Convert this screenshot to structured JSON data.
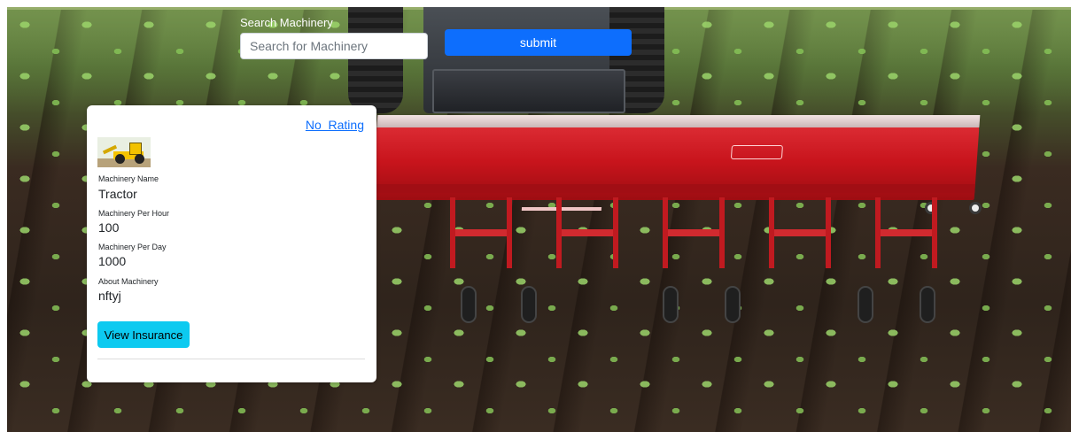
{
  "page": {
    "heading": ""
  },
  "search": {
    "label": "Search Machinery",
    "placeholder": "Search for Machinery",
    "value": "",
    "submit_label": "submit"
  },
  "card": {
    "rating_link": "No  Rating",
    "image_icon": "excavator-image",
    "fields": [
      {
        "label": "Machinery Name",
        "value": "Tractor"
      },
      {
        "label": "Machinery Per Hour",
        "value": "100"
      },
      {
        "label": "Machinery Per Day",
        "value": "1000"
      },
      {
        "label": "About Machinery",
        "value": "nftyj"
      }
    ],
    "insurance_button": "View Insurance"
  },
  "colors": {
    "primary": "#0d6efd",
    "info": "#0dcaf0",
    "implement_red": "#c8141c"
  }
}
